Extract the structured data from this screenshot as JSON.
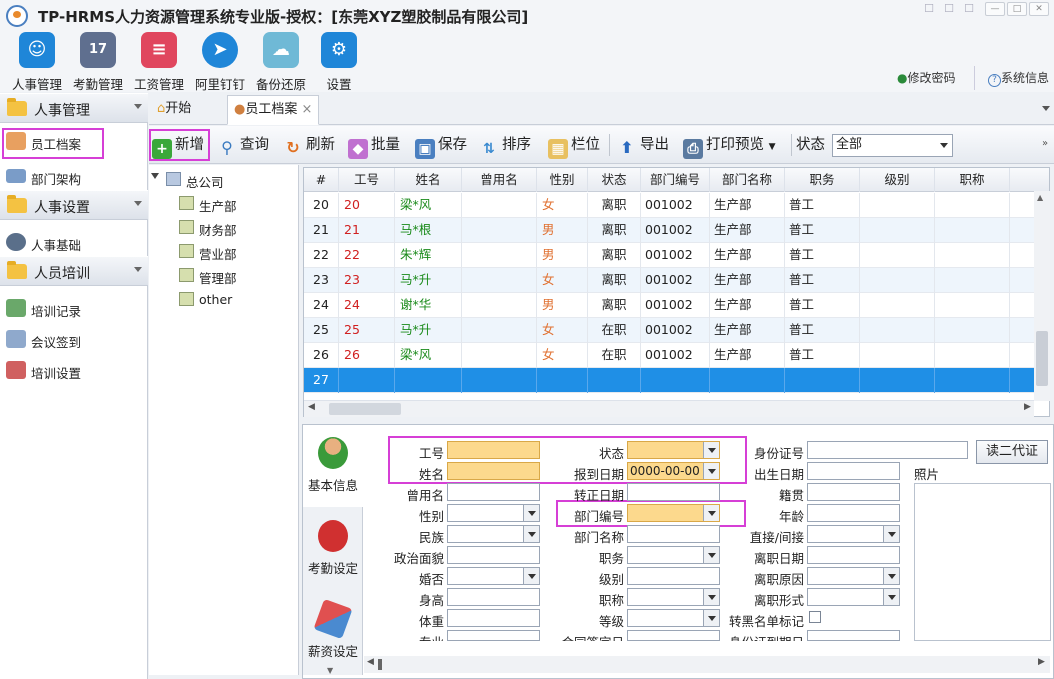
{
  "window": {
    "title": "TP-HRMS人力资源管理系统专业版-授权：[东莞XYZ塑胶制品有限公司]"
  },
  "ribbon": {
    "items": [
      {
        "label": "人事管理",
        "icon": "people-icon",
        "color": "#1f86d8"
      },
      {
        "label": "考勤管理",
        "icon": "calendar-icon",
        "color": "#5f6f8f"
      },
      {
        "label": "工资管理",
        "icon": "payroll-icon",
        "color": "#e0465e"
      },
      {
        "label": "阿里钉钉",
        "icon": "dingtalk-icon",
        "color": "#1f86d8"
      },
      {
        "label": "备份还原",
        "icon": "cloud-icon",
        "color": "#6fb9d6"
      },
      {
        "label": "设置",
        "icon": "gear-icon",
        "color": "#1f86d8"
      }
    ],
    "change_password": "修改密码",
    "system_info": "系统信息"
  },
  "sidebar": {
    "groups": [
      {
        "label": "人事管理",
        "items": [
          {
            "label": "员工档案",
            "icon": "employee-file-icon"
          },
          {
            "label": "部门架构",
            "icon": "org-chart-icon"
          }
        ]
      },
      {
        "label": "人事设置",
        "items": [
          {
            "label": "人事基础",
            "icon": "gear-icon"
          }
        ]
      },
      {
        "label": "人员培训",
        "items": [
          {
            "label": "培训记录",
            "icon": "training-record-icon"
          },
          {
            "label": "会议签到",
            "icon": "meeting-checkin-icon"
          },
          {
            "label": "培训设置",
            "icon": "training-settings-icon"
          }
        ]
      }
    ]
  },
  "tabs": [
    {
      "label": "开始",
      "icon": "home-icon"
    },
    {
      "label": "员工档案",
      "icon": "employee-file-icon",
      "close": "×"
    }
  ],
  "toolbar": {
    "add": "新增",
    "query": "查询",
    "refresh": "刷新",
    "batch": "批量",
    "save": "保存",
    "sort": "排序",
    "columns": "栏位",
    "export": "导出",
    "print_preview": "打印预览",
    "status_label": "状态",
    "status_value": "全部"
  },
  "tree": {
    "root": "总公司",
    "children": [
      "生产部",
      "财务部",
      "营业部",
      "管理部",
      "other"
    ]
  },
  "grid": {
    "columns": [
      "#",
      "工号",
      "姓名",
      "曾用名",
      "性别",
      "状态",
      "部门编号",
      "部门名称",
      "职务",
      "级别",
      "职称"
    ],
    "rows": [
      {
        "n": "20",
        "id": "20",
        "name": "梁*风",
        "alias": "",
        "gender": "女",
        "status": "离职",
        "dept_no": "001002",
        "dept_name": "生产部",
        "position": "普工"
      },
      {
        "n": "21",
        "id": "21",
        "name": "马*根",
        "alias": "",
        "gender": "男",
        "status": "离职",
        "dept_no": "001002",
        "dept_name": "生产部",
        "position": "普工"
      },
      {
        "n": "22",
        "id": "22",
        "name": "朱*辉",
        "alias": "",
        "gender": "男",
        "status": "离职",
        "dept_no": "001002",
        "dept_name": "生产部",
        "position": "普工"
      },
      {
        "n": "23",
        "id": "23",
        "name": "马*升",
        "alias": "",
        "gender": "女",
        "status": "离职",
        "dept_no": "001002",
        "dept_name": "生产部",
        "position": "普工"
      },
      {
        "n": "24",
        "id": "24",
        "name": "谢*华",
        "alias": "",
        "gender": "男",
        "status": "离职",
        "dept_no": "001002",
        "dept_name": "生产部",
        "position": "普工"
      },
      {
        "n": "25",
        "id": "25",
        "name": "马*升",
        "alias": "",
        "gender": "女",
        "status": "在职",
        "dept_no": "001002",
        "dept_name": "生产部",
        "position": "普工"
      },
      {
        "n": "26",
        "id": "26",
        "name": "梁*风",
        "alias": "",
        "gender": "女",
        "status": "在职",
        "dept_no": "001002",
        "dept_name": "生产部",
        "position": "普工"
      }
    ],
    "new_row_index": "27",
    "selection_color": "#1f8fe6"
  },
  "detail_tabs": [
    {
      "label": "基本信息",
      "icon": "person-icon"
    },
    {
      "label": "考勤设定",
      "icon": "ladybug-icon"
    },
    {
      "label": "薪资设定",
      "icon": "eraser-icon"
    }
  ],
  "form": {
    "emp_id": "工号",
    "name": "姓名",
    "former_name": "曾用名",
    "gender": "性别",
    "ethnicity": "民族",
    "political": "政治面貌",
    "marital": "婚否",
    "height": "身高",
    "weight": "体重",
    "major": "专业",
    "status": "状态",
    "report_date": "报到日期",
    "report_date_value": "0000-00-00",
    "confirm_date": "转正日期",
    "dept_no": "部门编号",
    "dept_name": "部门名称",
    "position": "职务",
    "level": "级别",
    "title": "职称",
    "grade": "等级",
    "contract_date": "合同签定日",
    "id_no": "身份证号",
    "birth_date": "出生日期",
    "native": "籍贯",
    "age": "年龄",
    "direct": "直接/间接",
    "leave_date": "离职日期",
    "leave_reason": "离职原因",
    "leave_form": "离职形式",
    "blacklist": "转黑名单标记",
    "id_expiry": "身份证到期日",
    "read_id_button": "读二代证",
    "photo": "照片"
  }
}
